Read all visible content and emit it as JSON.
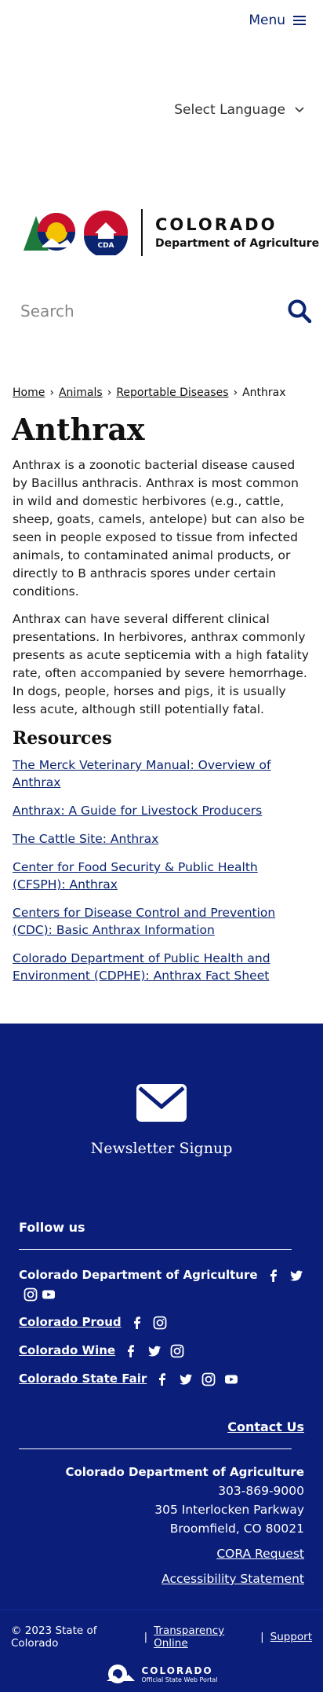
{
  "header": {
    "menu_label": "Menu",
    "language_label": "Select Language",
    "logo": {
      "title": "COLORADO",
      "subtitle": "Department of Agriculture",
      "badge": "CDA"
    },
    "search_placeholder": "Search"
  },
  "breadcrumb": {
    "items": [
      "Home",
      "Animals",
      "Reportable Diseases"
    ],
    "current": "Anthrax",
    "separator": "›"
  },
  "main": {
    "title": "Anthrax",
    "paragraphs": [
      "Anthrax is a zoonotic bacterial disease caused by Bacillus anthracis. Anthrax is most common in wild and domestic herbivores (e.g., cattle, sheep, goats, camels, antelope) but can also be seen in people exposed to tissue from infected animals, to contaminated animal products, or directly to B anthracis spores under certain conditions.",
      "Anthrax can have several different clinical presentations. In herbivores, anthrax commonly presents as acute septicemia with a high fatality rate, often accompanied by severe hemorrhage. In dogs, people, horses and pigs, it is usually less acute, although still potentially fatal."
    ],
    "resources_heading": "Resources",
    "resources": [
      "The Merck Veterinary Manual: Overview of Anthrax",
      "Anthrax: A Guide for Livestock Producers",
      "The Cattle Site: Anthrax",
      "Center for Food Security & Public Health (CFSPH): Anthrax",
      "Centers for Disease Control and Prevention (CDC): Basic Anthrax Information",
      "Colorado Department of Public Health and Environment (CDPHE): Anthrax Fact Sheet"
    ]
  },
  "footer": {
    "newsletter_label": "Newsletter Signup",
    "follow_heading": "Follow us",
    "social": [
      {
        "name": "Colorado Department of Agriculture",
        "icons": [
          "facebook-icon",
          "twitter-icon",
          "instagram-icon",
          "youtube-icon"
        ]
      },
      {
        "name": "Colorado Proud",
        "icons": [
          "facebook-icon",
          "instagram-icon"
        ]
      },
      {
        "name": "Colorado Wine",
        "icons": [
          "facebook-icon",
          "twitter-icon",
          "instagram-icon"
        ]
      },
      {
        "name": "Colorado State Fair",
        "icons": [
          "facebook-icon",
          "twitter-icon",
          "instagram-icon",
          "youtube-icon"
        ]
      }
    ],
    "contact_label": "Contact Us",
    "org_name": "Colorado Department of Agriculture",
    "phone": "303-869-9000",
    "address1": "305 Interlocken Parkway",
    "address2": "Broomfield, CO 80021",
    "cora_label": "CORA Request",
    "accessibility_label": "Accessibility Statement",
    "copyright": "© 2023 State of Colorado",
    "sep": "|",
    "transparency_label": "Transparency Online",
    "support_label": "Support",
    "portal_title": "COLORADO",
    "portal_subtitle": "Official State Web Portal"
  },
  "colors": {
    "brand_navy": "#0a1e7a",
    "link_blue": "#0a2470"
  }
}
